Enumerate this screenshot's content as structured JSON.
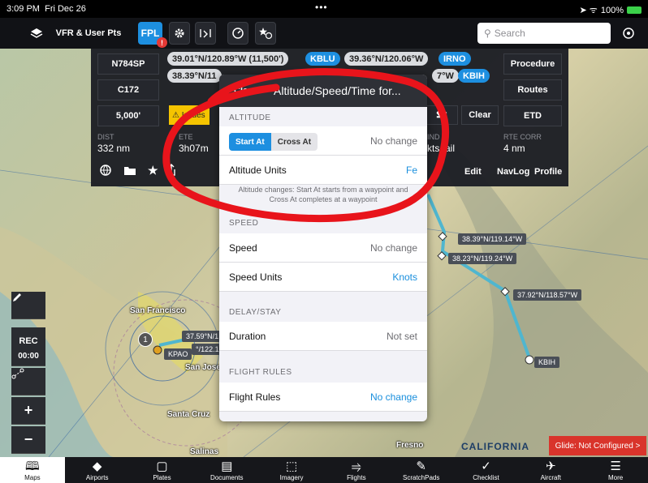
{
  "status": {
    "time": "3:09 PM",
    "date": "Fri Dec 26",
    "dots": "•••",
    "battery_text": "100%",
    "signal_icons": "➤ ᯤ"
  },
  "toolbar": {
    "layers_label": "VFR & User Pts",
    "fpl_label": "FPL",
    "fpl_badge": "!",
    "search_placeholder": "Search",
    "search_icon": "⚲"
  },
  "flight_plan": {
    "tail": "N784SP",
    "aircraft": "C172",
    "altitude": "5,000'",
    "route": [
      {
        "text": "39.01°N/120.89°W (11,500')",
        "style": "grey"
      },
      {
        "text": "KBLU",
        "style": "blue"
      },
      {
        "text": "39.36°N/120.06°W",
        "style": "grey"
      },
      {
        "text": "IRNO",
        "style": "blue"
      },
      {
        "text": "38.39°N/11",
        "style": "grey"
      },
      {
        "text": "7°W",
        "style": "grey"
      },
      {
        "text": "KBIH",
        "style": "blue"
      }
    ],
    "warning_text": "Issues",
    "buttons": {
      "procedure": "Procedure",
      "routes": "Routes",
      "etd": "ETD",
      "clear": "Clear",
      "edit": "Edit",
      "navlog": "NavLog",
      "profile": "Profile"
    },
    "stats": [
      {
        "label": "DIST",
        "value": "332 nm"
      },
      {
        "label": "ETE",
        "value": "3h07m"
      },
      {
        "label": "IND",
        "value": "kts tail"
      },
      {
        "label": "RTE CORR",
        "value": "4 nm"
      }
    ]
  },
  "popover": {
    "close_label": "Close",
    "title": "Altitude/Speed/Time for...",
    "sections": {
      "altitude": "ALTITUDE",
      "speed": "SPEED",
      "delay": "DELAY/STAY",
      "flight_rules": "FLIGHT RULES"
    },
    "segment": {
      "start_at": "Start At",
      "cross_at": "Cross At"
    },
    "altitude_value": "No change",
    "altitude_units_label": "Altitude Units",
    "altitude_units_value": "Fe",
    "note": "Altitude changes: Start At starts from a waypoint and Cross At completes at a waypoint",
    "speed_label": "Speed",
    "speed_value": "No change",
    "speed_units_label": "Speed Units",
    "speed_units_value": "Knots",
    "duration_label": "Duration",
    "duration_value": "Not set",
    "flight_rules_label": "Flight Rules",
    "flight_rules_value": "No change"
  },
  "map": {
    "waypoints": [
      "38.39°N/119.14°W",
      "38.23°N/119.24°W",
      "37.92°N/118.57°W",
      "KBIH",
      "37.59°N/1",
      "°/122.12",
      "KPAO"
    ],
    "place_labels": [
      "San Francisco",
      "San Jose",
      "Santa Cruz",
      "Salinas",
      "Fresno",
      "CALIFORNIA"
    ],
    "glide_label": "Glide: Not Configured >",
    "controls": {
      "rec": "REC",
      "timer": "00:00",
      "plus": "+",
      "minus": "−"
    },
    "marker_number": "1",
    "accent_color": "#1d8fe0",
    "annotation_color": "#e8141b"
  },
  "tabs": [
    {
      "label": "Maps",
      "icon": "🕮",
      "active": true
    },
    {
      "label": "Airports",
      "icon": "◆",
      "active": false
    },
    {
      "label": "Plates",
      "icon": "▢",
      "active": false
    },
    {
      "label": "Documents",
      "icon": "▤",
      "active": false
    },
    {
      "label": "Imagery",
      "icon": "⬚",
      "active": false
    },
    {
      "label": "Flights",
      "icon": "⥤",
      "active": false
    },
    {
      "label": "ScratchPads",
      "icon": "✎",
      "active": false
    },
    {
      "label": "Checklist",
      "icon": "✓",
      "active": false
    },
    {
      "label": "Aircraft",
      "icon": "✈",
      "active": false
    },
    {
      "label": "More",
      "icon": "☰",
      "active": false
    }
  ]
}
